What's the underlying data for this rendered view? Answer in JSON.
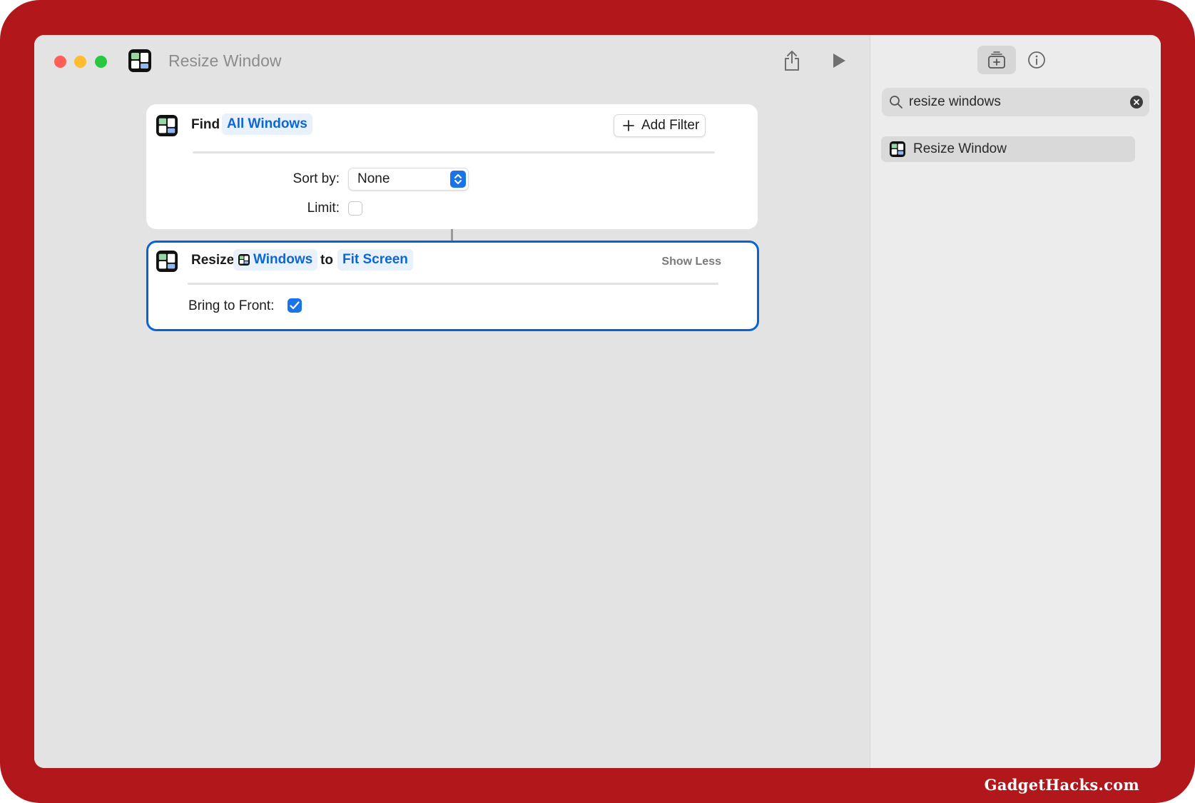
{
  "window": {
    "title": "Resize Window"
  },
  "actions": {
    "find": {
      "verb": "Find",
      "subject": "All Windows",
      "add_filter_label": "Add Filter",
      "sort_label": "Sort by:",
      "sort_value": "None",
      "limit_label": "Limit:",
      "limit_checked": false
    },
    "resize": {
      "verb": "Resize",
      "variable": "Windows",
      "connector": "to",
      "target": "Fit Screen",
      "toggle_label": "Show Less",
      "bring_front_label": "Bring to Front:",
      "bring_front_checked": true
    }
  },
  "sidebar": {
    "search_query": "resize windows",
    "results": [
      {
        "label": "Resize Window",
        "icon": "window-manager-icon"
      }
    ]
  },
  "icons": {
    "share": "share-icon",
    "run": "play-icon",
    "library": "action-library-icon",
    "info": "info-icon",
    "search": "search-icon",
    "clear": "clear-icon"
  },
  "colors": {
    "accent": "#1a73e8",
    "frame": "#b2171c",
    "token_text": "#0b67d8"
  },
  "watermark": "GadgetHacks.com"
}
